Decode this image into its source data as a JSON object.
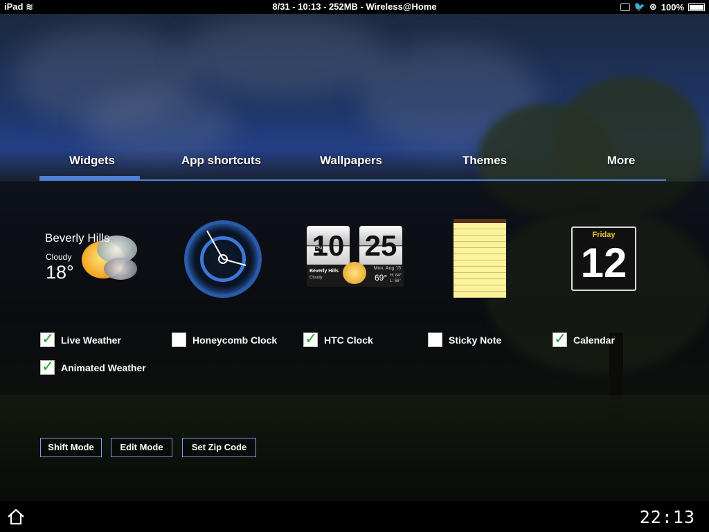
{
  "status_bar": {
    "device": "iPad",
    "center_text": "8/31 - 10:13 - 252MB - Wireless@Home",
    "battery": "100%",
    "icons": [
      "wifi-icon",
      "mail-icon",
      "twitter-icon",
      "orientation-lock-icon",
      "battery-icon"
    ]
  },
  "tabs": [
    {
      "label": "Widgets",
      "active": true
    },
    {
      "label": "App shortcuts",
      "active": false
    },
    {
      "label": "Wallpapers",
      "active": false
    },
    {
      "label": "Themes",
      "active": false
    },
    {
      "label": "More",
      "active": false
    }
  ],
  "weather_widget": {
    "city": "Beverly Hills",
    "condition": "Cloudy",
    "temp": "18°"
  },
  "htc_widget": {
    "hour": "10",
    "minute": "25",
    "ampm": "PM",
    "city": "Beverly Hills",
    "condition": "Cloudy",
    "date": "Mon, Aug 15",
    "temp": "69°",
    "high": "H: 84°",
    "low": "L: 66°"
  },
  "calendar_widget": {
    "day": "Friday",
    "date": "12"
  },
  "options": [
    {
      "label": "Live Weather",
      "checked": true
    },
    {
      "label": "Honeycomb Clock",
      "checked": false
    },
    {
      "label": "HTC Clock",
      "checked": true
    },
    {
      "label": "Sticky Note",
      "checked": false
    },
    {
      "label": "Calendar",
      "checked": true
    },
    {
      "label": "Animated Weather",
      "checked": true
    }
  ],
  "buttons": {
    "shift_mode": "Shift Mode",
    "edit_mode": "Edit Mode",
    "set_zip": "Set Zip Code"
  },
  "bottom_bar": {
    "time": "22:13"
  },
  "colors": {
    "accent": "#4f7fd6",
    "check": "#2ea52e"
  }
}
